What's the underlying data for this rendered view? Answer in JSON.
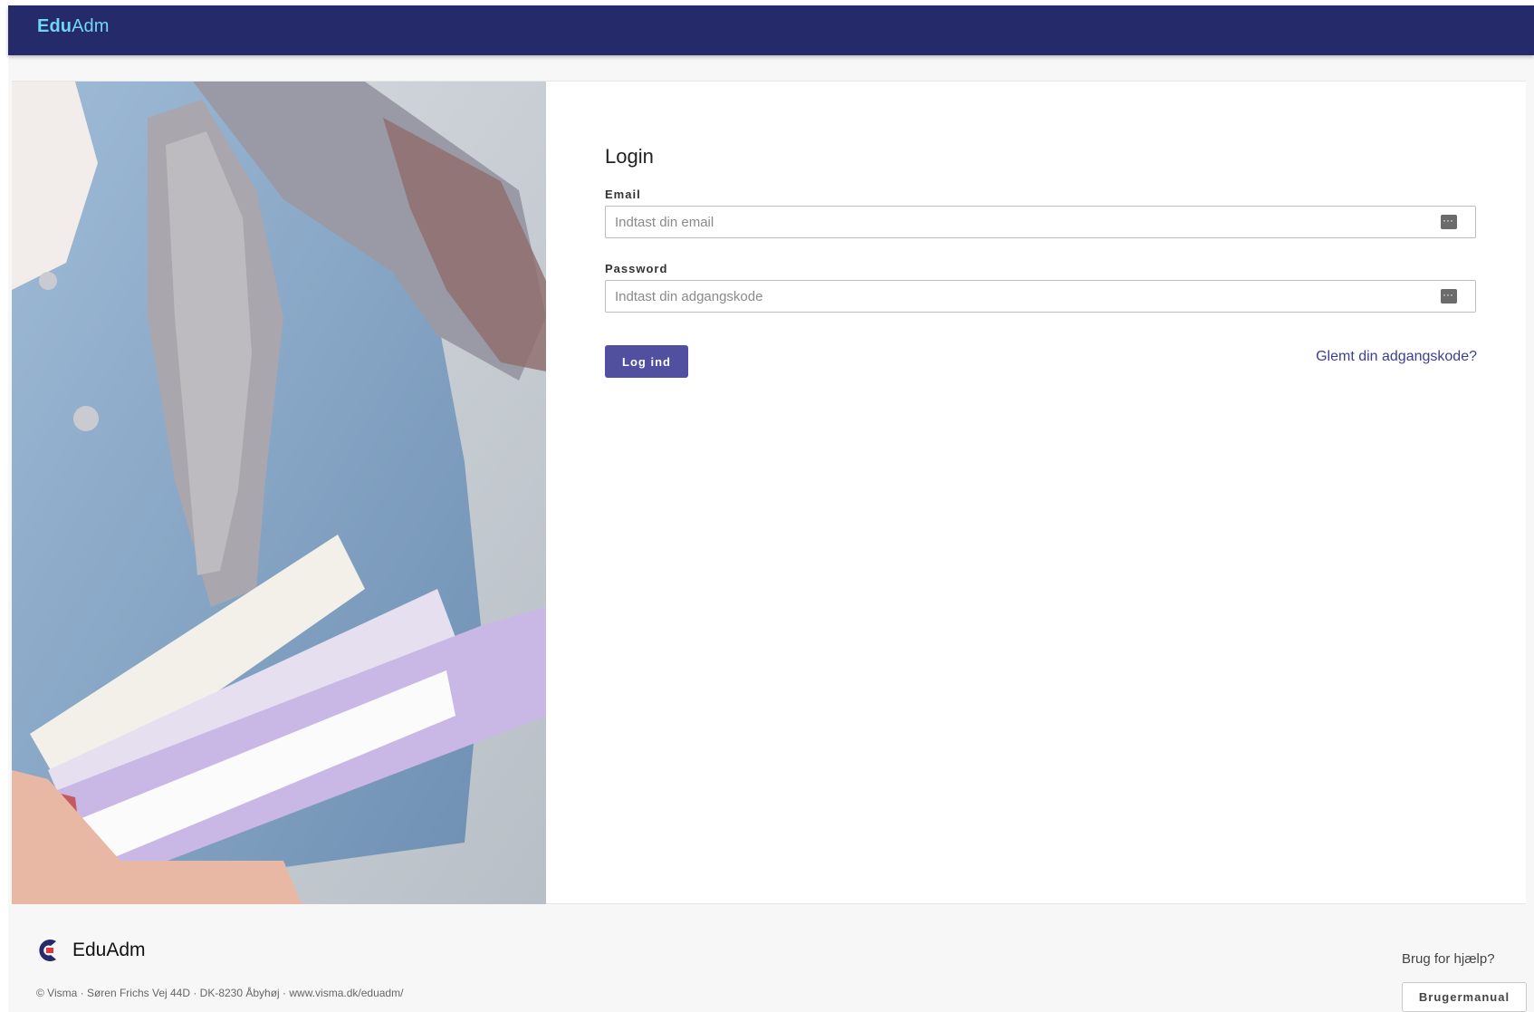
{
  "header": {
    "brand_bold": "Edu",
    "brand_regular": "Adm"
  },
  "login": {
    "title": "Login",
    "email_label": "Email",
    "email_placeholder": "Indtast din email",
    "password_label": "Password",
    "password_placeholder": "Indtast din adgangskode",
    "submit_label": "Log ind",
    "forgot_label": "Glemt din adgangskode?"
  },
  "footer": {
    "brand": "EduAdm",
    "copyright": "© Visma · Søren Frichs Vej 44D · DK-8230 Åbyhøj · www.visma.dk/eduadm/",
    "help_text": "Brug for hjælp?",
    "manual_label": "Brugermanual"
  },
  "colors": {
    "topbar": "#252a6b",
    "brand": "#6fd7f3",
    "primary_button": "#5150a0",
    "link": "#3d3f8e",
    "logo_red": "#e3373e",
    "logo_navy": "#252a6b"
  },
  "icons": {
    "field_icon": "password-manager-icon",
    "footer_logo": "visma-logo-icon"
  }
}
